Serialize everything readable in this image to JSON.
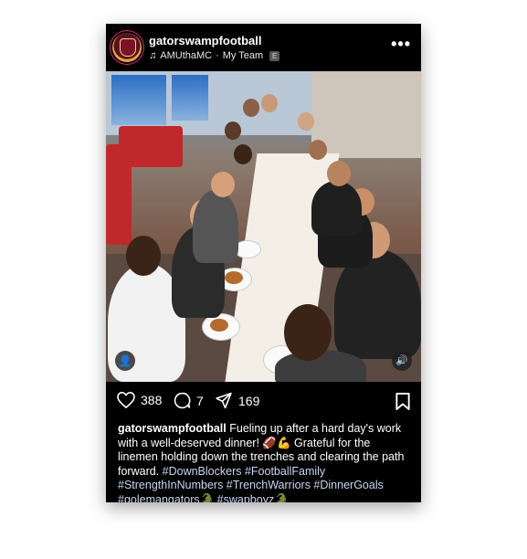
{
  "post": {
    "username": "gatorswampfootball",
    "music_artist": "AMUthaMC",
    "music_separator": " · ",
    "music_track": "My Team",
    "explicit_badge": "E",
    "more_icon": "more-horizontal-icon",
    "likes": "388",
    "comments": "7",
    "shares": "169",
    "caption_user": "gatorswampfootball",
    "caption_text": " Fueling up after a hard day's work with a well-deserved dinner! 🏈💪 Grateful for the linemen holding down the trenches and clearing the path forward. ",
    "hashtags": "#DownBlockers #FootballFamily #StrengthInNumbers #TrenchWarriors #DinnerGoals #golemangators🐊 #swapboyz🐊"
  },
  "colors": {
    "background": "#000000",
    "text": "#ffffff",
    "hashtag": "#c9d6f2"
  }
}
